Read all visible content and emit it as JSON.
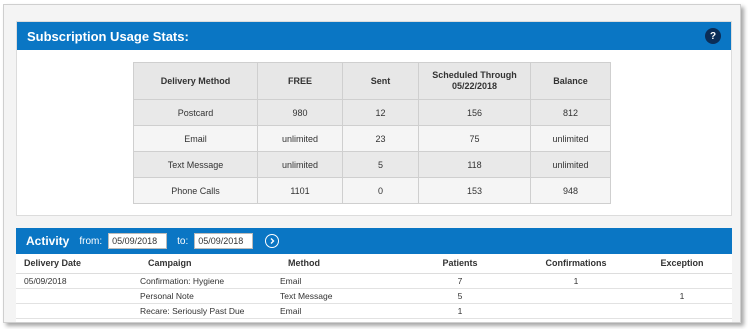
{
  "subscription": {
    "title": "Subscription Usage Stats:",
    "help_label": "?",
    "headers": [
      "Delivery Method",
      "FREE",
      "Sent",
      "Scheduled Through\n05/22/2018",
      "Balance"
    ],
    "rows": [
      [
        "Postcard",
        "980",
        "12",
        "156",
        "812"
      ],
      [
        "Email",
        "unlimited",
        "23",
        "75",
        "unlimited"
      ],
      [
        "Text Message",
        "unlimited",
        "5",
        "118",
        "unlimited"
      ],
      [
        "Phone Calls",
        "1101",
        "0",
        "153",
        "948"
      ]
    ]
  },
  "activity": {
    "title": "Activity",
    "from_label": "from:",
    "from_value": "05/09/2018",
    "to_label": "to:",
    "to_value": "05/09/2018",
    "headers": [
      "Delivery Date",
      "Campaign",
      "Method",
      "Patients",
      "Confirmations",
      "Exception"
    ],
    "rows": [
      {
        "date": "05/09/2018",
        "campaign": "Confirmation: Hygiene",
        "method": "Email",
        "patients": "7",
        "confirmations": "1",
        "exception": ""
      },
      {
        "date": "",
        "campaign": "Personal Note",
        "method": "Text Message",
        "patients": "5",
        "confirmations": "",
        "exception": "1"
      },
      {
        "date": "",
        "campaign": "Recare: Seriously Past Due",
        "method": "Email",
        "patients": "1",
        "confirmations": "",
        "exception": ""
      }
    ]
  },
  "colors": {
    "accent": "#0a76c4",
    "help": "#0b2d57",
    "link": "#2a78c0",
    "confirm": "#3a9a3a",
    "exception": "#c0262d"
  },
  "icons": {
    "help": "question-icon",
    "go": "chevron-right-circle-icon"
  }
}
